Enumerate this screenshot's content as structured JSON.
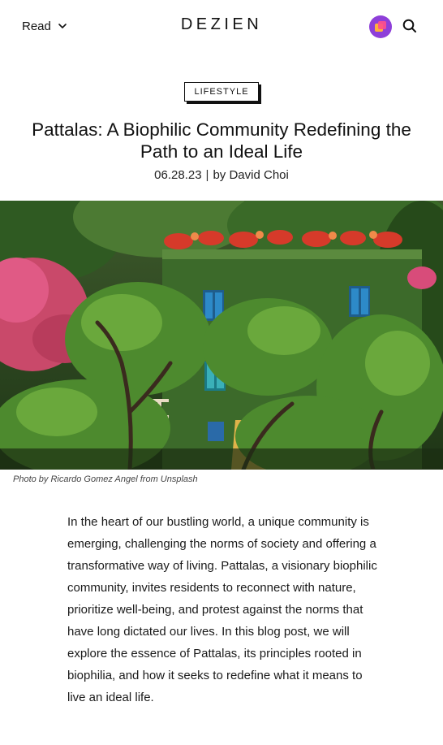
{
  "header": {
    "menu_label": "Read",
    "brand": "DEZIEN",
    "icons": {
      "menu": "chevron-down-icon",
      "app": "app-logo-icon",
      "search": "search-icon"
    }
  },
  "article": {
    "category": "LIFESTYLE",
    "title": "Pattalas: A Biophilic Community Redefining the Path to an Ideal Life",
    "date": "06.28.23",
    "separator": "|",
    "author": "by David Choi",
    "image_caption": "Photo by Ricardo Gomez Angel from Unsplash",
    "intro": "In the heart of our bustling world, a unique community is emerging, challenging the norms of society and offering a transformative way of living. Pattalas, a visionary biophilic community, invites residents to reconnect with nature, prioritize well-being, and protest against the norms that have long dictated our lives. In this blog post, we will explore the essence of Pattalas, its principles rooted in biophilia, and how it seeks to redefine what it means to live an ideal life."
  },
  "colors": {
    "accent": "#8e3fd9",
    "text": "#111111",
    "background": "#ffffff"
  }
}
